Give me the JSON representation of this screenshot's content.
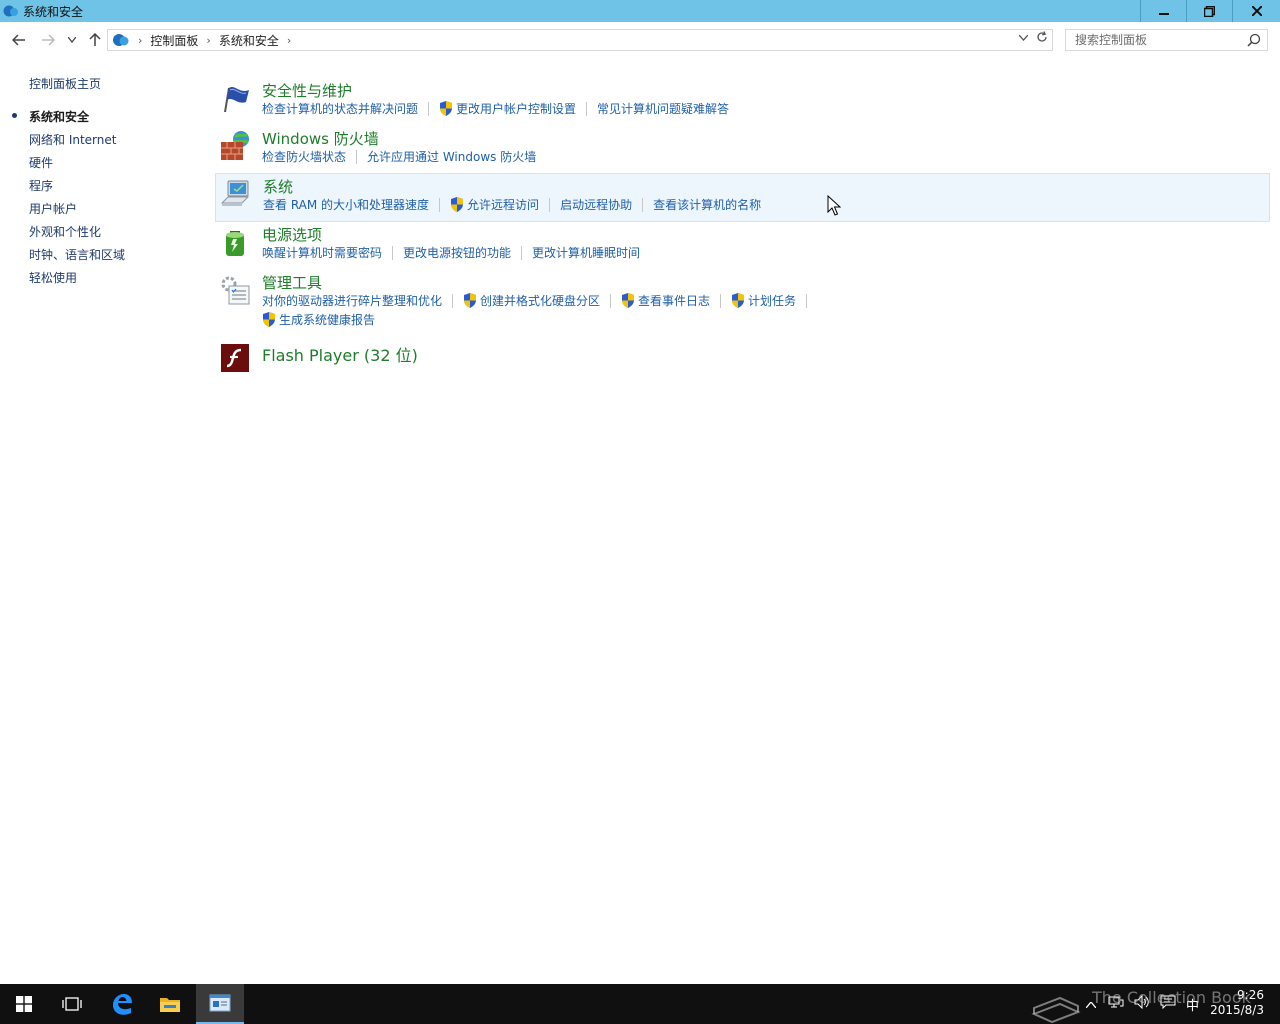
{
  "window": {
    "title": "系统和安全",
    "controls": {
      "minimize": "–",
      "maximize": "❐",
      "close": "✕"
    }
  },
  "address": {
    "crumbs": [
      "控制面板",
      "系统和安全"
    ],
    "search_placeholder": "搜索控制面板"
  },
  "leftnav": {
    "home": "控制面板主页",
    "items": [
      "系统和安全",
      "网络和 Internet",
      "硬件",
      "程序",
      "用户帐户",
      "外观和个性化",
      "时钟、语言和区域",
      "轻松使用"
    ],
    "current": "系统和安全"
  },
  "categories": [
    {
      "title": "安全性与维护",
      "icon": "flag-icon",
      "links": [
        "检查计算机的状态并解决问题",
        "更改用户帐户控制设置",
        "常见计算机问题疑难解答"
      ]
    },
    {
      "title": "Windows 防火墙",
      "icon": "firewall-icon",
      "links": [
        "检查防火墙状态",
        "允许应用通过 Windows 防火墙"
      ]
    },
    {
      "title": "系统",
      "icon": "computer-icon",
      "links": [
        "查看 RAM 的大小和处理器速度",
        "允许远程访问",
        "启动远程协助",
        "查看该计算机的名称"
      ]
    },
    {
      "title": "电源选项",
      "icon": "battery-icon",
      "links": [
        "唤醒计算机时需要密码",
        "更改电源按钮的功能",
        "更改计算机睡眠时间"
      ]
    },
    {
      "title": "管理工具",
      "icon": "admin-tools-icon",
      "links": [
        "对你的驱动器进行碎片整理和优化",
        "创建并格式化硬盘分区",
        "查看事件日志",
        "计划任务"
      ],
      "links2": [
        "生成系统健康报告"
      ]
    },
    {
      "title": "Flash Player (32 位)",
      "icon": "flash-icon",
      "links": []
    }
  ],
  "taskbar": {
    "time": "9:26",
    "date": "2015/8/3",
    "ime": "中"
  },
  "watermark": "The Collection Book"
}
